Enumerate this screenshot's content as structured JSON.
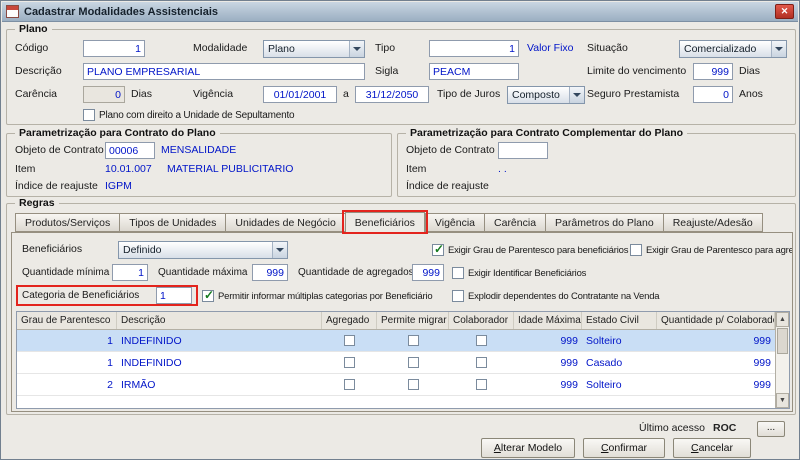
{
  "window": {
    "title": "Cadastrar Modalidades Assistenciais",
    "close_glyph": "✕"
  },
  "plano": {
    "group_title": "Plano",
    "codigo": {
      "label": "Código",
      "value": "1"
    },
    "modalidade": {
      "label": "Modalidade",
      "value": "Plano"
    },
    "tipo": {
      "label": "Tipo",
      "value": "1",
      "suffix": "Valor Fixo"
    },
    "situacao": {
      "label": "Situação",
      "value": "Comercializado"
    },
    "descricao": {
      "label": "Descrição",
      "value": "PLANO EMPRESARIAL"
    },
    "sigla": {
      "label": "Sigla",
      "value": "PEACM"
    },
    "limite": {
      "label": "Limite do vencimento",
      "value": "999",
      "suffix": "Dias"
    },
    "carencia": {
      "label": "Carência",
      "value": "0",
      "suffix": "Dias"
    },
    "vigencia": {
      "label": "Vigência",
      "from": "01/01/2001",
      "sep": "a",
      "to": "31/12/2050"
    },
    "juros": {
      "label": "Tipo de Juros",
      "value": "Composto"
    },
    "seguro": {
      "label": "Seguro Prestamista",
      "value": "0",
      "suffix": "Anos"
    },
    "sepultamento": {
      "label": "Plano com direito a Unidade de Sepultamento",
      "checked": false
    }
  },
  "contrato": {
    "group_title": "Parametrização para Contrato do Plano",
    "objeto": {
      "label": "Objeto de Contrato",
      "value": "00006",
      "desc": "MENSALIDADE"
    },
    "item": {
      "label": "Item",
      "code": "10.01.007",
      "desc": "MATERIAL PUBLICITARIO"
    },
    "indice": {
      "label": "Índice de reajuste",
      "value": "IGPM"
    }
  },
  "complementar": {
    "group_title": "Parametrização para Contrato Complementar do Plano",
    "objeto": {
      "label": "Objeto de Contrato",
      "value": ""
    },
    "item": {
      "label": "Item",
      "code": ". .",
      "desc": ""
    },
    "indice": {
      "label": "Índice de reajuste",
      "value": ""
    }
  },
  "regras": {
    "group_title": "Regras",
    "tabs": [
      "Produtos/Serviços",
      "Tipos de Unidades",
      "Unidades de Negócio",
      "Beneficiários",
      "Vigência",
      "Carência",
      "Parâmetros do Plano",
      "Reajuste/Adesão"
    ],
    "active_tab": "Beneficiários",
    "beneficiarios": {
      "label": "Beneficiários",
      "value": "Definido"
    },
    "chk_grau_benef": {
      "label": "Exigir Grau de Parentesco para beneficiários",
      "checked": true
    },
    "chk_grau_agreg": {
      "label": "Exigir Grau de Parentesco para agregados",
      "checked": false
    },
    "qtd_min": {
      "label": "Quantidade mínima",
      "value": "1"
    },
    "qtd_max": {
      "label": "Quantidade máxima",
      "value": "999"
    },
    "qtd_agreg": {
      "label": "Quantidade de agregados",
      "value": "999"
    },
    "chk_identificar": {
      "label": "Exigir Identificar Beneficiários",
      "checked": false
    },
    "categoria": {
      "label": "Categoria de Beneficiários",
      "value": "1"
    },
    "chk_multiplas": {
      "label": "Permitir informar múltiplas categorias por Beneficiário",
      "checked": true
    },
    "chk_explodir": {
      "label": "Explodir dependentes do Contratante na Venda",
      "checked": false
    },
    "table": {
      "headers": [
        "Grau de Parentesco",
        "Descrição",
        "Agregado",
        "Permite migrar",
        "Colaborador",
        "Idade Máxima",
        "Estado Civil",
        "Quantidade p/ Colaborador"
      ],
      "rows": [
        {
          "grau": "1",
          "descricao": "INDEFINIDO",
          "agregado": false,
          "permite_migrar": false,
          "colaborador": false,
          "idade_maxima": "999",
          "estado_civil": "Solteiro",
          "qtd_colaborador": "999",
          "selected": true
        },
        {
          "grau": "1",
          "descricao": "INDEFINIDO",
          "agregado": false,
          "permite_migrar": false,
          "colaborador": false,
          "idade_maxima": "999",
          "estado_civil": "Casado",
          "qtd_colaborador": "999",
          "selected": false
        },
        {
          "grau": "2",
          "descricao": "IRMÃO",
          "agregado": false,
          "permite_migrar": false,
          "colaborador": false,
          "idade_maxima": "999",
          "estado_civil": "Solteiro",
          "qtd_colaborador": "999",
          "selected": false
        }
      ]
    }
  },
  "footer": {
    "last_access_label": "Último acesso",
    "last_access_value": "ROC",
    "more_button": "...",
    "buttons": [
      "Alterar Modelo",
      "Confirmar",
      "Cancelar"
    ]
  }
}
